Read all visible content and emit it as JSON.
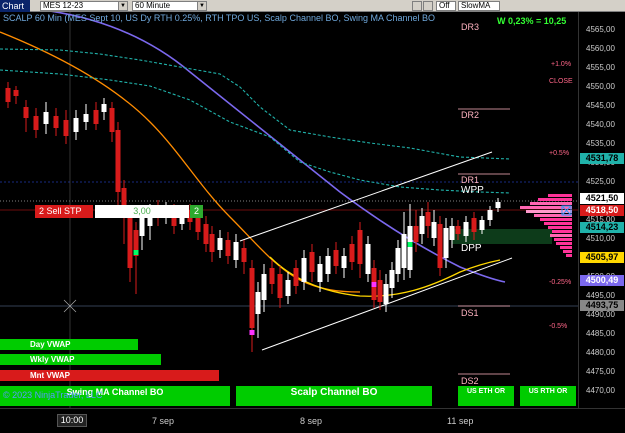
{
  "toolbar": {
    "tab_label": "Chart",
    "instrument": "MES 12-23",
    "interval": "60 Minute",
    "toggle": "Off",
    "indicator": "SlowMA"
  },
  "header": {
    "title": "SCALP 60 Min (MES Sept 10, US Dy RTH 0.25%, RTH TPO US, Scalp Channel BO, Swing MA Channel BO",
    "pnl": "W 0,23% = 10,25"
  },
  "levels": {
    "dr2": "DR2",
    "dr1": "DR1",
    "wpp": "WPP",
    "dpp": "DPP",
    "ds1": "DS1",
    "ds2": "DS2",
    "top": "DR3",
    "close": "CLOSE",
    "pct_p1": "+1.0%",
    "pct_p05": "+0.5%",
    "pct_m025": "-0.25%",
    "pct_m05": "-0.5%"
  },
  "price_axis": {
    "ticks": [
      "4565,00",
      "4560,00",
      "4555,00",
      "4550,00",
      "4545,00",
      "4540,00",
      "4535,00",
      "4530,00",
      "4525,00",
      "4520,00",
      "4515,00",
      "4510,00",
      "4505,00",
      "4500,00",
      "4495,00",
      "4490,00",
      "4485,00",
      "4480,00",
      "4475,00",
      "4470,00"
    ],
    "boxes": [
      {
        "label": "4531,78",
        "bg": "#20b2aa",
        "fg": "#000000"
      },
      {
        "label": "4521,50",
        "bg": "#ffffff",
        "fg": "#000000"
      },
      {
        "label": "4518,50",
        "bg": "#d81b1b",
        "fg": "#ffffff"
      },
      {
        "label": "4514,23",
        "bg": "#20b2aa",
        "fg": "#000000"
      },
      {
        "label": "4505,97",
        "bg": "#ffd700",
        "fg": "#000000"
      },
      {
        "label": "4500,49",
        "bg": "#7b68ee",
        "fg": "#ffffff"
      },
      {
        "label": "4493,75",
        "bg": "#888888",
        "fg": "#000000"
      }
    ]
  },
  "order": {
    "sell_label": "2  Sell STP",
    "price": "3,00",
    "qty": "2"
  },
  "indicators": {
    "day_vwap": "Day VWAP",
    "wkly_vwap": "Wkly VWAP",
    "mnt_vwap": "Mnt VWAP",
    "swing_bo": "Swing MA Channel BO",
    "scalp_bo": "Scalp Channel BO",
    "us_eth": "US ETH OR",
    "us_rth": "US RTH OR"
  },
  "footer": {
    "copyright": "© 2023 NinjaTrader, LLC"
  },
  "time_axis": {
    "time": "10:00",
    "dates": [
      "7 sep",
      "8 sep",
      "11 sep"
    ]
  },
  "colors": {
    "bull": "#ffffff",
    "bear": "#d81b1b",
    "slow_ma": "#7b68ee",
    "fast_ma": "#ff8c00",
    "channel": "#20b2aa",
    "vwap": "#ffd700",
    "green": "#00cc00"
  },
  "chart_data": {
    "type": "candlestick",
    "series": [
      {
        "name": "SlowMA",
        "values": [
          4572,
          4571,
          4569,
          4566,
          4561,
          4555,
          4547,
          4539,
          4530,
          4522,
          4514,
          4508,
          4503,
          4500,
          4499
        ]
      },
      {
        "name": "Scalp Channel",
        "values": [
          4540,
          4539,
          4538,
          4537,
          4536,
          4534,
          4533,
          4532,
          4531,
          4530,
          4530,
          4531,
          4532,
          4532,
          4531
        ]
      }
    ],
    "ylim": [
      4467,
      4569
    ]
  }
}
